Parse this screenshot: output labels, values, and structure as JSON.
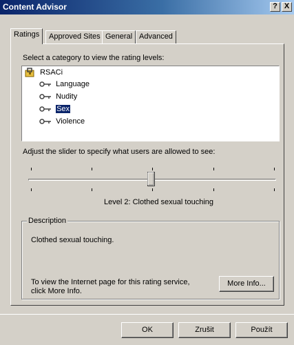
{
  "window": {
    "title": "Content Advisor",
    "help_label": "?",
    "close_label": "X"
  },
  "tabs": [
    {
      "label": "Ratings"
    },
    {
      "label": "Approved Sites"
    },
    {
      "label": "General"
    },
    {
      "label": "Advanced"
    }
  ],
  "category": {
    "label": "Select a category to view the rating levels:",
    "tree": {
      "root": "RSACi",
      "items": [
        {
          "label": "Language",
          "selected": false
        },
        {
          "label": "Nudity",
          "selected": false
        },
        {
          "label": "Sex",
          "selected": true
        },
        {
          "label": "Violence",
          "selected": false
        }
      ]
    }
  },
  "slider": {
    "label": "Adjust the slider to specify what users are allowed to see:",
    "level": 2,
    "max_level": 4,
    "level_text": "Level 2:  Clothed sexual touching"
  },
  "description": {
    "title": "Description",
    "text": "Clothed sexual touching.",
    "info_text_1": "To view the Internet page for this rating service,",
    "info_text_2": "click More Info.",
    "more_info_label": "More Info..."
  },
  "buttons": {
    "ok": "OK",
    "cancel": "Zrušit",
    "apply": "Použít"
  },
  "colors": {
    "titlebar": "#0a246a",
    "selection": "#0a246a",
    "face": "#d4d0c8"
  }
}
